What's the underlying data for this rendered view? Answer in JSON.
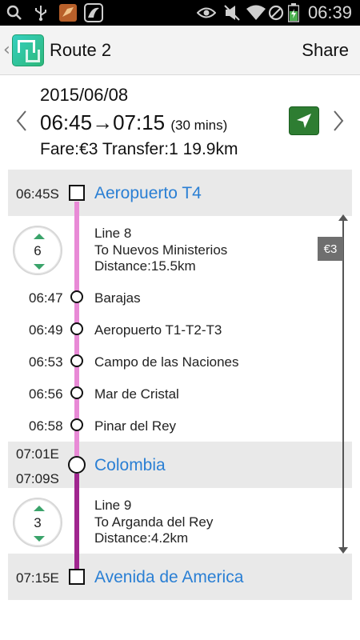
{
  "status_bar": {
    "time": "06:39",
    "left_icons": [
      "search-icon",
      "usb-icon",
      "app-notification-icon",
      "app-notification-icon-2"
    ],
    "right_icons": [
      "eye-icon",
      "mute-icon",
      "wifi-icon",
      "blocked-icon",
      "battery-icon"
    ]
  },
  "action_bar": {
    "title": "Route 2",
    "share_label": "Share"
  },
  "summary": {
    "date": "2015/06/08",
    "depart": "06:45",
    "arrow": "→",
    "arrive": "07:15",
    "duration": "(30 mins)",
    "fare_line": "Fare:€3 Transfer:1 19.9km"
  },
  "colors": {
    "line8": "#e88ad6",
    "line9": "#a0268f",
    "station_text": "#2a7fd4",
    "nav_button": "#2e7d32"
  },
  "itinerary": {
    "origin": {
      "time": "06:45S",
      "name": "Aeropuerto T4"
    },
    "segment1": {
      "stops_count": "6",
      "line": "Line 8",
      "direction": "To Nuevos Ministerios",
      "distance": "Distance:15.5km",
      "intermediate_stops": [
        {
          "time": "06:47",
          "name": "Barajas"
        },
        {
          "time": "06:49",
          "name": "Aeropuerto T1-T2-T3"
        },
        {
          "time": "06:53",
          "name": "Campo de las Naciones"
        },
        {
          "time": "06:56",
          "name": "Mar de Cristal"
        },
        {
          "time": "06:58",
          "name": "Pinar del Rey"
        }
      ]
    },
    "transfer": {
      "arrive_time": "07:01E",
      "depart_time": "07:09S",
      "name": "Colombia"
    },
    "segment2": {
      "stops_count": "3",
      "line": "Line 9",
      "direction": "To Arganda del Rey",
      "distance": "Distance:4.2km"
    },
    "destination": {
      "time": "07:15E",
      "name": "Avenida de America"
    },
    "fare_tag": "€3"
  }
}
